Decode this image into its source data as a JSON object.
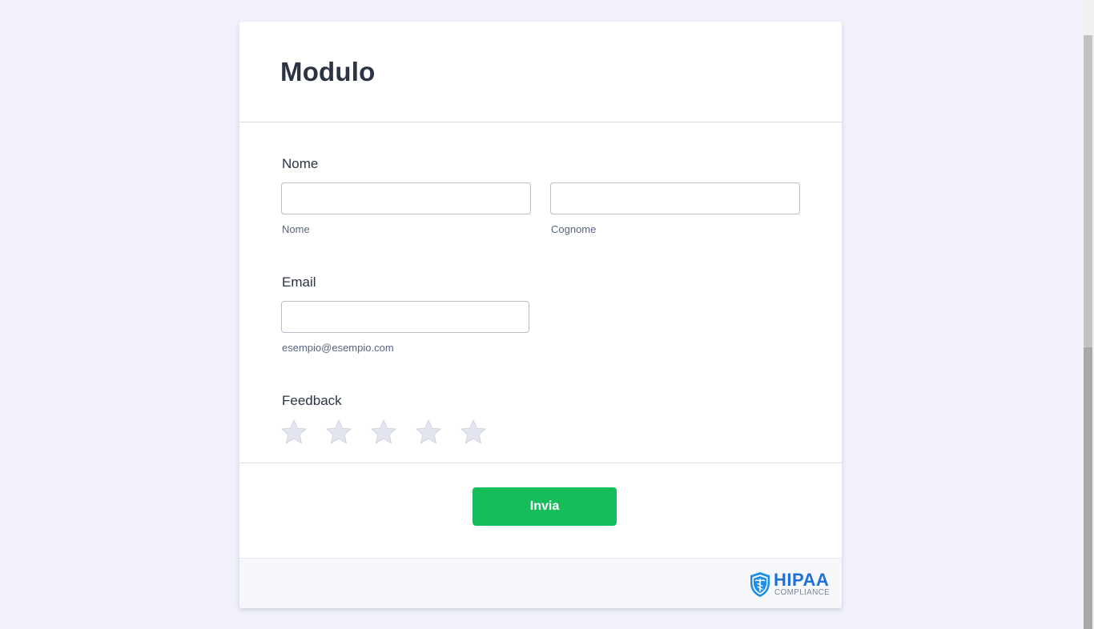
{
  "form": {
    "title": "Modulo",
    "name_field": {
      "label": "Nome",
      "first_sublabel": "Nome",
      "last_sublabel": "Cognome",
      "first_value": "",
      "last_value": ""
    },
    "email_field": {
      "label": "Email",
      "sublabel": "esempio@esempio.com",
      "value": ""
    },
    "feedback_field": {
      "label": "Feedback",
      "rating": 0,
      "max_rating": 5
    },
    "submit_label": "Invia"
  },
  "footer": {
    "badge_main": "HIPAA",
    "badge_sub": "COMPLIANCE",
    "badge_icon": "shield-caduceus-icon"
  },
  "colors": {
    "submit": "#18bd5b",
    "star_empty": "#e3e5ef",
    "badge_blue": "#1e6fd6"
  }
}
